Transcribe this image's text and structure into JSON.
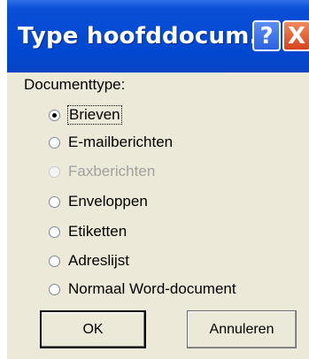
{
  "window": {
    "title": "Type hoofddocum...",
    "help_button": "?",
    "close_button": "X"
  },
  "group": {
    "label": "Documenttype:"
  },
  "options": [
    {
      "label": "Brieven",
      "selected": true,
      "enabled": true
    },
    {
      "label": "E-mailberichten",
      "selected": false,
      "enabled": true
    },
    {
      "label": "Faxberichten",
      "selected": false,
      "enabled": false
    },
    {
      "label": "Enveloppen",
      "selected": false,
      "enabled": true
    },
    {
      "label": "Etiketten",
      "selected": false,
      "enabled": true
    },
    {
      "label": "Adreslijst",
      "selected": false,
      "enabled": true
    },
    {
      "label": "Normaal Word-document",
      "selected": false,
      "enabled": true
    }
  ],
  "buttons": {
    "ok": "OK",
    "cancel": "Annuleren"
  }
}
